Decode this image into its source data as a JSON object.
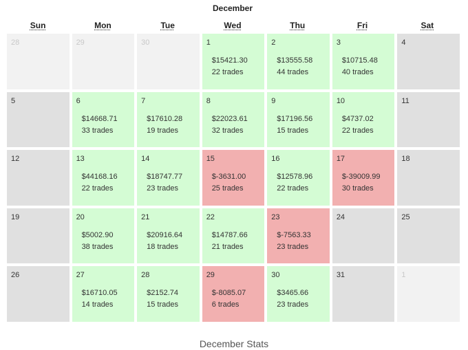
{
  "calendar": {
    "month_title": "December",
    "weekdays": [
      "Sun",
      "Mon",
      "Tue",
      "Wed",
      "Thu",
      "Fri",
      "Sat"
    ],
    "weeks": [
      [
        {
          "day": "28",
          "type": "other"
        },
        {
          "day": "29",
          "type": "other"
        },
        {
          "day": "30",
          "type": "other"
        },
        {
          "day": "1",
          "type": "profit",
          "pl": "$15421.30",
          "trades": "22 trades"
        },
        {
          "day": "2",
          "type": "profit",
          "pl": "$13555.58",
          "trades": "44 trades"
        },
        {
          "day": "3",
          "type": "profit",
          "pl": "$10715.48",
          "trades": "40 trades"
        },
        {
          "day": "4",
          "type": "neutral"
        }
      ],
      [
        {
          "day": "5",
          "type": "neutral"
        },
        {
          "day": "6",
          "type": "profit",
          "pl": "$14668.71",
          "trades": "33 trades"
        },
        {
          "day": "7",
          "type": "profit",
          "pl": "$17610.28",
          "trades": "19 trades"
        },
        {
          "day": "8",
          "type": "profit",
          "pl": "$22023.61",
          "trades": "32 trades"
        },
        {
          "day": "9",
          "type": "profit",
          "pl": "$17196.56",
          "trades": "15 trades"
        },
        {
          "day": "10",
          "type": "profit",
          "pl": "$4737.02",
          "trades": "22 trades"
        },
        {
          "day": "11",
          "type": "neutral"
        }
      ],
      [
        {
          "day": "12",
          "type": "neutral"
        },
        {
          "day": "13",
          "type": "profit",
          "pl": "$44168.16",
          "trades": "22 trades"
        },
        {
          "day": "14",
          "type": "profit",
          "pl": "$18747.77",
          "trades": "23 trades"
        },
        {
          "day": "15",
          "type": "loss",
          "pl": "$-3631.00",
          "trades": "25 trades"
        },
        {
          "day": "16",
          "type": "profit",
          "pl": "$12578.96",
          "trades": "22 trades"
        },
        {
          "day": "17",
          "type": "loss",
          "pl": "$-39009.99",
          "trades": "30 trades"
        },
        {
          "day": "18",
          "type": "neutral"
        }
      ],
      [
        {
          "day": "19",
          "type": "neutral"
        },
        {
          "day": "20",
          "type": "profit",
          "pl": "$5002.90",
          "trades": "38 trades"
        },
        {
          "day": "21",
          "type": "profit",
          "pl": "$20916.64",
          "trades": "18 trades"
        },
        {
          "day": "22",
          "type": "profit",
          "pl": "$14787.66",
          "trades": "21 trades"
        },
        {
          "day": "23",
          "type": "loss",
          "pl": "$-7563.33",
          "trades": "23 trades"
        },
        {
          "day": "24",
          "type": "neutral"
        },
        {
          "day": "25",
          "type": "neutral"
        }
      ],
      [
        {
          "day": "26",
          "type": "neutral"
        },
        {
          "day": "27",
          "type": "profit",
          "pl": "$16710.05",
          "trades": "14 trades"
        },
        {
          "day": "28",
          "type": "profit",
          "pl": "$2152.74",
          "trades": "15 trades"
        },
        {
          "day": "29",
          "type": "loss",
          "pl": "$-8085.07",
          "trades": "6 trades"
        },
        {
          "day": "30",
          "type": "profit",
          "pl": "$3465.66",
          "trades": "23 trades"
        },
        {
          "day": "31",
          "type": "neutral"
        },
        {
          "day": "1",
          "type": "other"
        }
      ]
    ]
  },
  "stats": {
    "title": "December Stats"
  },
  "colors": {
    "profit": "#d4fcd4",
    "loss": "#f2b0b0",
    "neutral": "#e0e0e0",
    "other_month": "#f2f2f2"
  }
}
